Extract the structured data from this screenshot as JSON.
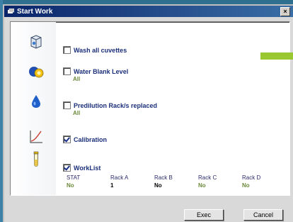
{
  "dialog": {
    "title": "Start Work",
    "close_glyph": "×"
  },
  "options": [
    {
      "label": "Wash all cuvettes",
      "checked": false,
      "icon": "cuvette-icon"
    },
    {
      "label": "Water Blank Level",
      "checked": false,
      "sub": "All",
      "icon": "water-blank-icon"
    },
    {
      "label": "Predilution Rack/s replaced",
      "checked": false,
      "sub": "All",
      "icon": "drop-icon"
    },
    {
      "label": "Calibration",
      "checked": true,
      "icon": "calibration-curve-icon"
    },
    {
      "label": "WorkList",
      "checked": true,
      "icon": "test-tube-icon"
    }
  ],
  "worklist": {
    "headers": [
      "STAT",
      "Rack A",
      "Rack B",
      "Rack C",
      "Rack D"
    ],
    "values": [
      "No",
      "1",
      "No",
      "No",
      "No"
    ]
  },
  "buttons": {
    "exec": "Exec",
    "cancel": "Cancel"
  },
  "colors": {
    "title_bar": "#0a246a",
    "label_text": "#1b2f7a",
    "sub_text": "#6b8a3a",
    "accent_green": "#9ac832",
    "background_frame": "#2f6f8f"
  }
}
